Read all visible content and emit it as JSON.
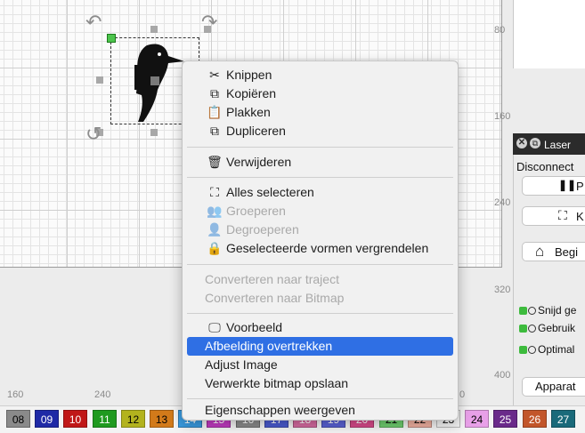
{
  "canvas": {
    "ruler_v": [
      "80",
      "160",
      "240",
      "320",
      "400"
    ],
    "ruler_h": [
      "160",
      "240",
      "3",
      "0"
    ]
  },
  "context_menu": {
    "items": [
      {
        "label": "Knippen",
        "icon": "scissors-icon",
        "glyph": "✂",
        "enabled": true
      },
      {
        "label": "Kopiëren",
        "icon": "copy-icon",
        "glyph": "⧉",
        "enabled": true
      },
      {
        "label": "Plakken",
        "icon": "clipboard-icon",
        "glyph": "📋",
        "enabled": true
      },
      {
        "label": "Dupliceren",
        "icon": "duplicate-icon",
        "glyph": "⧉",
        "enabled": true
      },
      {
        "label": "Verwijderen",
        "icon": "trash-icon",
        "glyph": "🗑",
        "enabled": true
      },
      {
        "label": "Alles selecteren",
        "icon": "select-all-icon",
        "glyph": "⛶",
        "enabled": true
      },
      {
        "label": "Groeperen",
        "icon": "group-icon",
        "glyph": "👥",
        "enabled": false
      },
      {
        "label": "Degroeperen",
        "icon": "ungroup-icon",
        "glyph": "👤",
        "enabled": false
      },
      {
        "label": "Geselecteerde vormen vergrendelen",
        "icon": "lock-icon",
        "glyph": "🔒",
        "enabled": true
      },
      {
        "label": "Converteren naar traject",
        "enabled": false
      },
      {
        "label": "Converteren naar Bitmap",
        "enabled": false
      },
      {
        "label": "Voorbeeld",
        "icon": "monitor-icon",
        "glyph": "🖵",
        "enabled": true
      },
      {
        "label": "Afbeelding overtrekken",
        "enabled": true,
        "highlighted": true
      },
      {
        "label": "Adjust Image",
        "enabled": true
      },
      {
        "label": "Verwerkte bitmap opslaan",
        "enabled": true
      },
      {
        "label": "Eigenschappen weergeven",
        "enabled": true
      }
    ]
  },
  "laser_panel": {
    "title": "Laser",
    "status": "Disconnect",
    "buttons": [
      {
        "label": "P",
        "icon": "pause-icon",
        "glyph": "❚❚"
      },
      {
        "label": "K",
        "icon": "frame-icon",
        "glyph": "⛶"
      },
      {
        "label": "Begi",
        "icon": "home-icon",
        "glyph": "⌂"
      }
    ],
    "checks": [
      "Snijd ge",
      "Gebruik",
      "Optimal"
    ],
    "devices_button": "Apparat"
  },
  "palette": [
    {
      "label": "08",
      "color": "#8a8a8a",
      "text": "#000000"
    },
    {
      "label": "09",
      "color": "#1f2aa6",
      "text": "#ffffff"
    },
    {
      "label": "10",
      "color": "#c01818",
      "text": "#ffffff"
    },
    {
      "label": "11",
      "color": "#1f9a1f",
      "text": "#ffffff"
    },
    {
      "label": "12",
      "color": "#b3b31e",
      "text": "#000000"
    },
    {
      "label": "13",
      "color": "#d27a1a",
      "text": "#000000"
    },
    {
      "label": "14",
      "color": "#3a9be0",
      "text": "#ffffff"
    },
    {
      "label": "15",
      "color": "#c23bc2",
      "text": "#ffffff"
    },
    {
      "label": "16",
      "color": "#8a8a8a",
      "text": "#ffffff"
    },
    {
      "label": "17",
      "color": "#4a5bd0",
      "text": "#ffffff"
    },
    {
      "label": "18",
      "color": "#d66aa0",
      "text": "#ffffff"
    },
    {
      "label": "19",
      "color": "#5a62d6",
      "text": "#ffffff"
    },
    {
      "label": "20",
      "color": "#d94a8a",
      "text": "#ffffff"
    },
    {
      "label": "21",
      "color": "#6fcf6f",
      "text": "#000000"
    },
    {
      "label": "22",
      "color": "#f0b0a0",
      "text": "#000000"
    },
    {
      "label": "23",
      "color": "#f3f3f3",
      "text": "#000000"
    },
    {
      "label": "24",
      "color": "#e8a0e8",
      "text": "#000000"
    },
    {
      "label": "25",
      "color": "#6a2a8a",
      "text": "#ffffff"
    },
    {
      "label": "26",
      "color": "#c2562a",
      "text": "#ffffff"
    },
    {
      "label": "27",
      "color": "#1a6a7a",
      "text": "#ffffff"
    }
  ]
}
